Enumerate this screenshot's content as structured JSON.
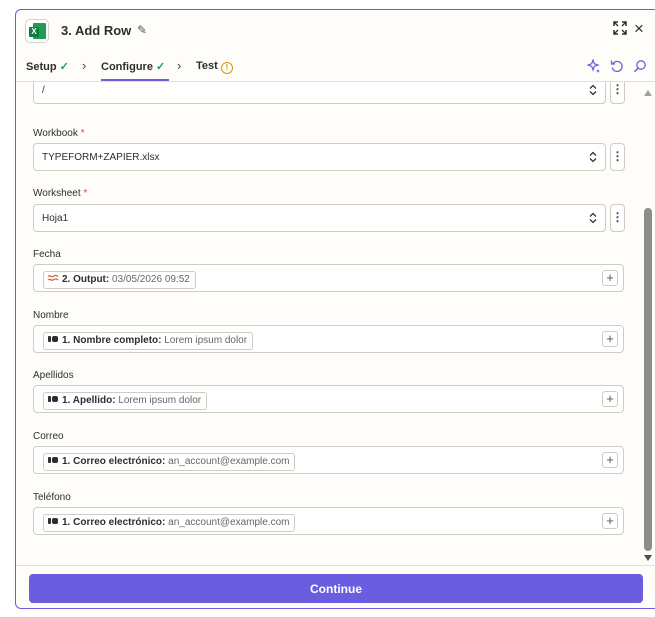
{
  "header": {
    "step_title": "3. Add Row",
    "app_icon": "microsoft-excel-icon"
  },
  "tabs": [
    {
      "label": "Setup",
      "status": "complete"
    },
    {
      "label": "Configure",
      "status": "complete",
      "active": true
    },
    {
      "label": "Test",
      "status": "warning"
    }
  ],
  "fields": {
    "drive_value": "/",
    "workbook": {
      "label": "Workbook",
      "required_mark": "*",
      "value": "TYPEFORM+ZAPIER.xlsx"
    },
    "worksheet": {
      "label": "Worksheet",
      "required_mark": "*",
      "value": "Hoja1"
    },
    "fecha": {
      "label": "Fecha",
      "pill_name": "2. Output:",
      "pill_value": "03/05/2026 09:52"
    },
    "nombre": {
      "label": "Nombre",
      "pill_name": "1. Nombre completo:",
      "pill_value": "Lorem ipsum dolor"
    },
    "apellidos": {
      "label": "Apellidos",
      "pill_name": "1. Apellido:",
      "pill_value": "Lorem ipsum dolor"
    },
    "correo": {
      "label": "Correo",
      "pill_name": "1. Correo electrónico:",
      "pill_value": "an_account@example.com"
    },
    "telefono": {
      "label": "Teléfono",
      "pill_name": "1. Correo electrónico:",
      "pill_value": "an_account@example.com"
    }
  },
  "footer": {
    "continue_label": "Continue"
  },
  "colors": {
    "accent": "#6a5de0",
    "success": "#1f9d55",
    "warning": "#c8a000",
    "required": "#e0443b"
  }
}
